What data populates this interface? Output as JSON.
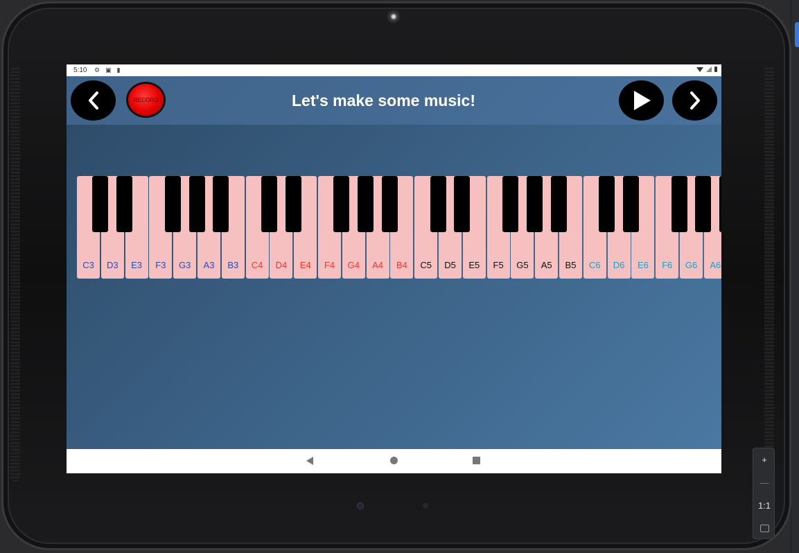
{
  "status_bar": {
    "time": "5:10",
    "left_icons": [
      "settings-icon",
      "a-icon",
      "sd-card-icon"
    ],
    "right_icons": [
      "wifi-icon",
      "signal-icon",
      "battery-icon"
    ]
  },
  "app": {
    "title": "Let's make some music!",
    "record_label": "RECORD",
    "back_icon": "‹",
    "play_icon": "▶",
    "next_icon": "›"
  },
  "keyboard": {
    "white_keys": [
      {
        "label": "C3",
        "color": "#2a4db0"
      },
      {
        "label": "D3",
        "color": "#2a4db0"
      },
      {
        "label": "E3",
        "color": "#2a4db0"
      },
      {
        "label": "F3",
        "color": "#2a4db0"
      },
      {
        "label": "G3",
        "color": "#2a4db0"
      },
      {
        "label": "A3",
        "color": "#2a4db0"
      },
      {
        "label": "B3",
        "color": "#2a4db0"
      },
      {
        "label": "C4",
        "color": "#e53935"
      },
      {
        "label": "D4",
        "color": "#e53935"
      },
      {
        "label": "E4",
        "color": "#e53935"
      },
      {
        "label": "F4",
        "color": "#e53935"
      },
      {
        "label": "G4",
        "color": "#e53935"
      },
      {
        "label": "A4",
        "color": "#e53935"
      },
      {
        "label": "B4",
        "color": "#e53935"
      },
      {
        "label": "C5",
        "color": "#111111"
      },
      {
        "label": "D5",
        "color": "#111111"
      },
      {
        "label": "E5",
        "color": "#111111"
      },
      {
        "label": "F5",
        "color": "#111111"
      },
      {
        "label": "G5",
        "color": "#111111"
      },
      {
        "label": "A5",
        "color": "#111111"
      },
      {
        "label": "B5",
        "color": "#111111"
      },
      {
        "label": "C6",
        "color": "#1aa0c8"
      },
      {
        "label": "D6",
        "color": "#1aa0c8"
      },
      {
        "label": "E6",
        "color": "#1aa0c8"
      },
      {
        "label": "F6",
        "color": "#1aa0c8"
      },
      {
        "label": "G6",
        "color": "#1aa0c8"
      },
      {
        "label": "A6",
        "color": "#1aa0c8"
      }
    ],
    "black_key_pattern": [
      1,
      1,
      0,
      1,
      1,
      1,
      0
    ],
    "white_key_color": "#f6bfc0",
    "black_key_color": "#000000"
  },
  "nav_bar": {
    "items": [
      "back-icon",
      "home-icon",
      "recents-icon"
    ]
  },
  "emulator_zoom": {
    "zoom_in": "+",
    "zoom_out": "—",
    "actual_size": "1:1",
    "fit_icon": "fit-screen-icon"
  }
}
